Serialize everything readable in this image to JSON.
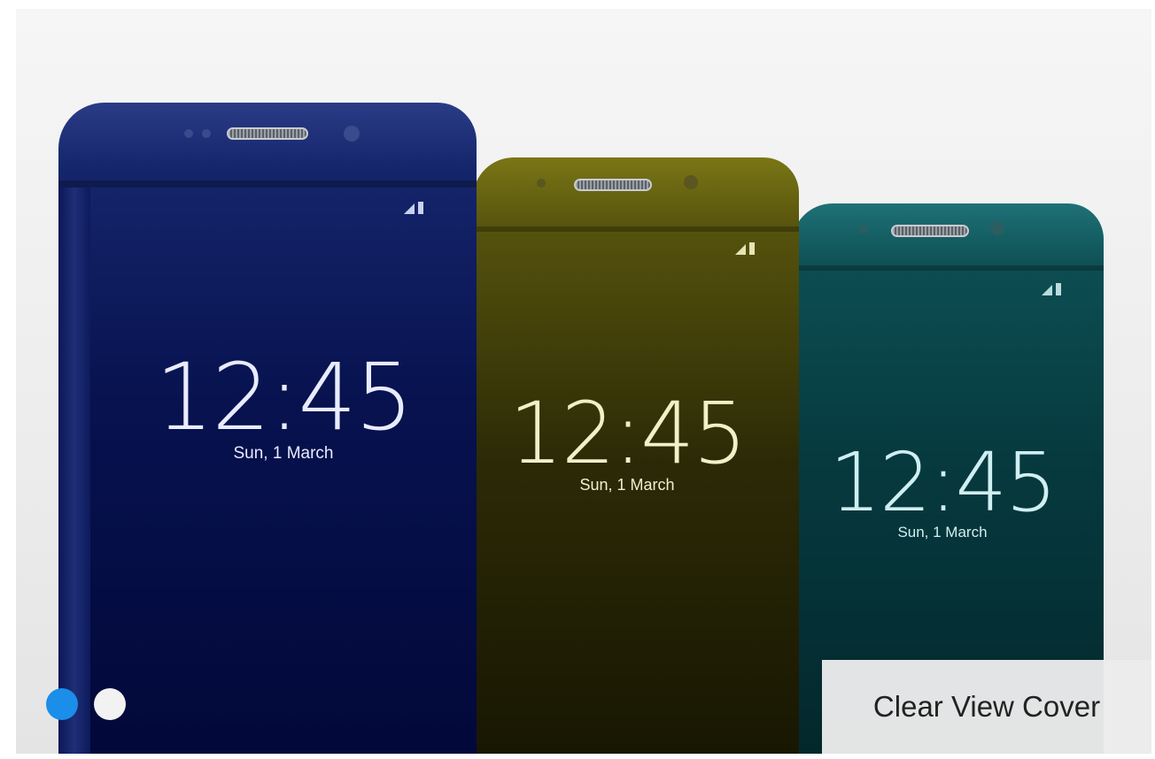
{
  "carousel": {
    "slides": [
      {
        "clock": "12:45",
        "date": "Sun, 1 March",
        "color_top": "#1b2f7a",
        "color_bottom": "#020a3a",
        "text_color": "#e8ecff"
      },
      {
        "clock": "12:45",
        "date": "Sun, 1 March",
        "color_top": "#6f6d12",
        "color_bottom": "#1a1a04",
        "text_color": "#f3f0c8"
      },
      {
        "clock": "12:45",
        "date": "Sun, 1 March",
        "color_top": "#0f5f63",
        "color_bottom": "#04282c",
        "text_color": "#cfeff2"
      }
    ],
    "indicators": [
      {
        "active": true,
        "color": "#1a8ee8"
      },
      {
        "active": false,
        "color": "#f2f2f2"
      }
    ],
    "caption": "Clear View Cover"
  }
}
